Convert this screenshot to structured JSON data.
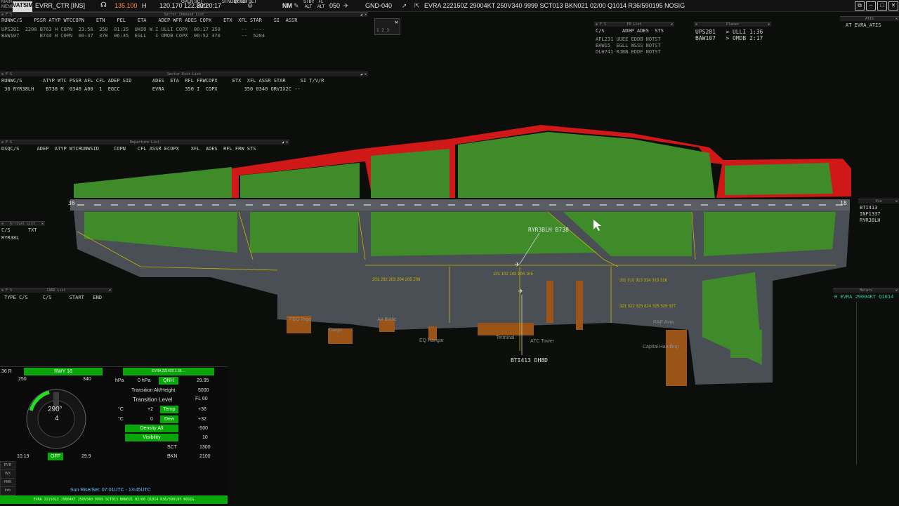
{
  "topbar": {
    "logo": "VATSIM",
    "title": "EVRR_CTR [INS]",
    "freq_primary": "135.100",
    "freq_mode": "H",
    "freq_secondary": "120.170",
    "freq_tertiary": "122.800",
    "clock": "22:20:17",
    "open_sct": "OPEN SCT",
    "stdby_set": "STNDBY SET",
    "quick_set": "QUICK SET",
    "nm": "NM",
    "trans_alt": "050",
    "position": "GND-040",
    "metar": "EVRA 222150Z 29004KT 250V340 9999 SCT013 BKN021 02/00 Q1014 R36/590195 NOSIG"
  },
  "inbound": {
    "title": "Sector Inbound List",
    "header": "RUNWC/S    PSSR ATYP WTCCOPN    ETN    PEL    ETA    ADEP WFR ADES COPX    ETX  XFL STAR    SI  ASSR",
    "rows": [
      "UPS281  2200 B763 H COPN  23:56  350  01:35  UKOO W I ULLI COPX  00:17 350       --  ----",
      "BAW107       B744 H COPN  00:37  370  06:35  EGLL   I OMDB COPX  00:52 370       --  5204"
    ]
  },
  "exit_list": {
    "title": "Sector Exit List",
    "header": "RUNWC/S       ATYP WTC PSSR AFL CFL ADEP SID       ADES  ETA  RFL FRWCOPX     ETX  XFL ASSR STAR     SI T/V/R",
    "rows": [
      " 36 RYR38LH    B738 M  0340 A00  1  EGCC           EVRA       350 I  COPX         350 0340 ORVIX2C --"
    ]
  },
  "departure": {
    "title": "Departure List",
    "header": "DSQC/S      ADEP  ATYP WTCRUNWSID     COPN    CFL ASSR ECOPX    XFL  ADES  RFL FRW STS"
  },
  "arrival": {
    "title": "Arrival List",
    "header": "C/S      TXT",
    "rows": [
      "RYR38L"
    ]
  },
  "card": {
    "title": "CARD List",
    "header": "TYPE C/S     C/S      START   END"
  },
  "fplist": {
    "title": "FP List",
    "header": "C/S      ADEP ADES  STS",
    "rows": [
      "AFL231 UUEE EDDB NOTST",
      "BAW15  EGLL WSSS NOTST",
      "DLH741 RJBB EDDF NOTST"
    ]
  },
  "planes": {
    "title": "Planes",
    "rows": [
      "UPS281   > ULLI 1:36",
      "BAW107   > OMDB 2:17"
    ]
  },
  "atis": {
    "title": "ATIS",
    "text": "AT EVRA_ATIS"
  },
  "via": {
    "title": "Via",
    "rows": [
      "BTI413",
      "INF1337",
      "RYR38LH"
    ]
  },
  "metars_panel": {
    "title": "Metars",
    "text": "H EVRA 29004KT Q1014"
  },
  "mini_window": {
    "nums": [
      "1",
      "2",
      "3"
    ]
  },
  "weather": {
    "runway": "RWY 18",
    "wind_dir": "290°",
    "wind_speed": "4",
    "compass_left": "250",
    "compass_right": "340",
    "atis_banner": "EVRA 221420 1.35 ...",
    "qnh_label": "QNH",
    "qnh_value": "0 hPa",
    "qnh_inhg": "29.95",
    "trans_alt_label": "Transition Alt/Height",
    "trans_alt_value": "5000",
    "trans_level_label": "Transition Level",
    "trans_level_value": "FL 60",
    "temp_label": "Temp",
    "temp_c": "+2",
    "temp_f": "+36",
    "dew_label": "Dew",
    "dew_c": "0",
    "dew_f": "+32",
    "density_label": "Density Alt",
    "density_value": "-500",
    "visibility_label": "Visibility",
    "visibility_value": "10",
    "cloud1_type": "SCT",
    "cloud1_ft": "1300",
    "cloud2_type": "BKN",
    "cloud2_ft": "2100",
    "off_label": "OFF",
    "off_value": "29.9",
    "left_pressure": "10.19",
    "side_buttons": [
      "RVR",
      "WX",
      "HMK",
      "Info"
    ],
    "sunrise": "Sun Rise/Set: 07:01UTC - 13:45UTC",
    "status": "EVRA 221502Z 29004KT 250V340 9999 SCT013 BKN021 02/00 Q1014 R36/590195 NOSIG"
  },
  "map": {
    "runway_36": "36",
    "runway_18": "18",
    "tag_ryr": "RYR38LH B738",
    "tag_bti": "BTI413  DH8D",
    "label_fbo": "FBO Riga",
    "label_cargo": "Cargo",
    "label_airbaltic": "Air Baltic",
    "label_eq_hangar": "EQ Hangar",
    "label_terminal": "Terminal",
    "label_atc_tower": "ATC Tower",
    "label_raf_avia": "RAF Avia",
    "label_capital": "Capital Handling",
    "stands_a": "101 102 103 104 105",
    "stands_b": "201 202 203 204 205 206",
    "stands_c": "311 312 313 314 315 316",
    "stands_d": "321 322 323 324 325 326 327"
  },
  "colors": {
    "grass": "#3f8b2a",
    "pavement": "#4a4f55",
    "runway": "#5a5d62",
    "restricted": "#d01818",
    "building": "#9a5418",
    "taxiline": "#c8b400"
  }
}
